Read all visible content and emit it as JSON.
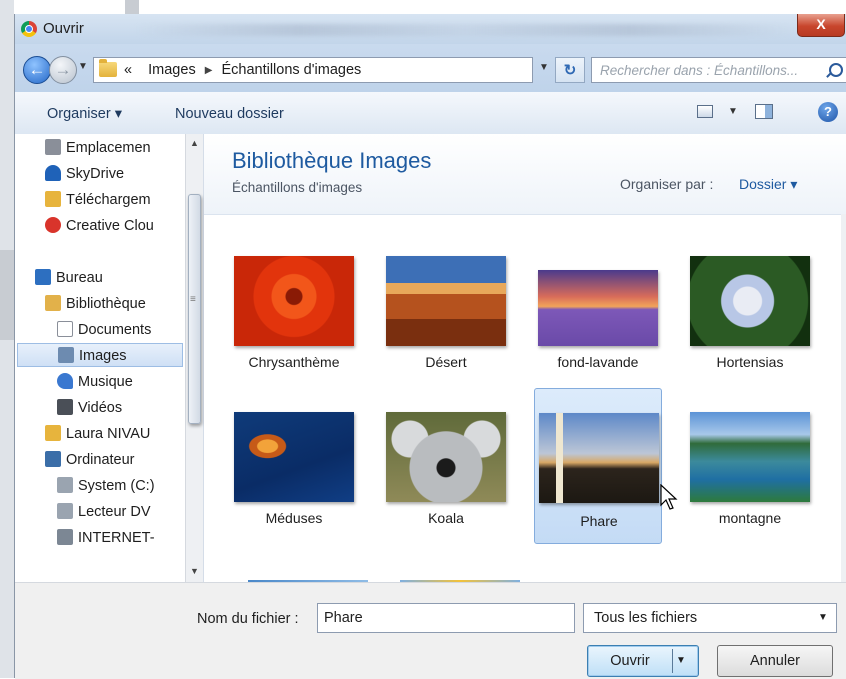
{
  "window": {
    "title": "Ouvrir",
    "close_label": "X"
  },
  "address": {
    "overflow": "«",
    "crumbs": [
      "Images",
      "Échantillons d'images"
    ],
    "search_placeholder": "Rechercher dans : Échantillons..."
  },
  "toolbar": {
    "organize": "Organiser ▾",
    "new_folder": "Nouveau dossier",
    "help": "?"
  },
  "sidebar": {
    "items": [
      {
        "label": "Emplacemen",
        "icon": "recent-places-icon",
        "color": "#8a8f99"
      },
      {
        "label": "SkyDrive",
        "icon": "skydrive-icon",
        "color": "#1f62b8"
      },
      {
        "label": "Téléchargem",
        "icon": "downloads-folder-icon",
        "color": "#e7b43d"
      },
      {
        "label": "Creative Clou",
        "icon": "creative-cloud-icon",
        "color": "#d9342b"
      },
      {
        "label": "Bureau",
        "icon": "desktop-icon",
        "color": "#2d6fc0"
      },
      {
        "label": "Bibliothèque",
        "icon": "libraries-icon",
        "color": "#e2b14a"
      },
      {
        "label": "Documents",
        "icon": "documents-icon",
        "color": "#c9ced6"
      },
      {
        "label": "Images",
        "icon": "pictures-icon",
        "color": "#6d8bb0"
      },
      {
        "label": "Musique",
        "icon": "music-icon",
        "color": "#3a78d0"
      },
      {
        "label": "Vidéos",
        "icon": "videos-icon",
        "color": "#4a4f57"
      },
      {
        "label": "Laura NIVAU",
        "icon": "user-folder-icon",
        "color": "#e7b43d"
      },
      {
        "label": "Ordinateur",
        "icon": "computer-icon",
        "color": "#3b6ea8"
      },
      {
        "label": "System (C:)",
        "icon": "drive-c-icon",
        "color": "#9aa4b0"
      },
      {
        "label": "Lecteur DV",
        "icon": "dvd-drive-icon",
        "color": "#9aa4b0"
      },
      {
        "label": "INTERNET-",
        "icon": "network-drive-icon",
        "color": "#7c8794"
      }
    ]
  },
  "library": {
    "title": "Bibliothèque Images",
    "subtitle": "Échantillons d'images",
    "arrange_label": "Organiser par :",
    "arrange_value": "Dossier ▾"
  },
  "files": [
    {
      "name": "Chrysanthème"
    },
    {
      "name": "Désert"
    },
    {
      "name": "fond-lavande"
    },
    {
      "name": "Hortensias"
    },
    {
      "name": "Méduses"
    },
    {
      "name": "Koala"
    },
    {
      "name": "Phare",
      "selected": true
    },
    {
      "name": "montagne"
    }
  ],
  "footer": {
    "filename_label": "Nom du fichier :",
    "filename_value": "Phare",
    "filetype_value": "Tous les fichiers",
    "open_label": "Ouvrir",
    "cancel_label": "Annuler"
  }
}
